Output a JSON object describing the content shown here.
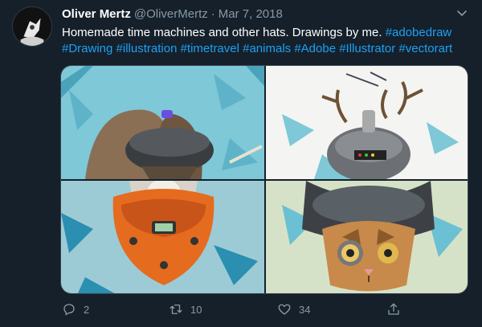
{
  "tweet": {
    "author_name": "Oliver Mertz",
    "author_handle": "@OliverMertz",
    "separator": "·",
    "date": "Mar 7, 2018",
    "text_plain": "Homemade time machines and other hats. Drawings by me. ",
    "hashtags": [
      "#adobedraw",
      "#Drawing",
      "#illustration",
      "#timetravel",
      "#animals",
      "#Adobe",
      "#Illustrator",
      "#vectorart"
    ]
  },
  "actions": {
    "reply_count": "2",
    "retweet_count": "10",
    "like_count": "34"
  },
  "icons": {
    "reply": "reply-icon",
    "retweet": "retweet-icon",
    "like": "heart-icon",
    "share": "share-icon",
    "caret": "chevron-down-icon"
  },
  "colors": {
    "background": "#15202b",
    "link": "#1da1f2",
    "muted": "#8899a6",
    "text": "#ffffff"
  },
  "media": {
    "images": [
      {
        "subject": "ram with helmet hat"
      },
      {
        "subject": "deer with time machine helmet"
      },
      {
        "subject": "dog with orange helmet"
      },
      {
        "subject": "cat with goggles helmet"
      }
    ]
  }
}
